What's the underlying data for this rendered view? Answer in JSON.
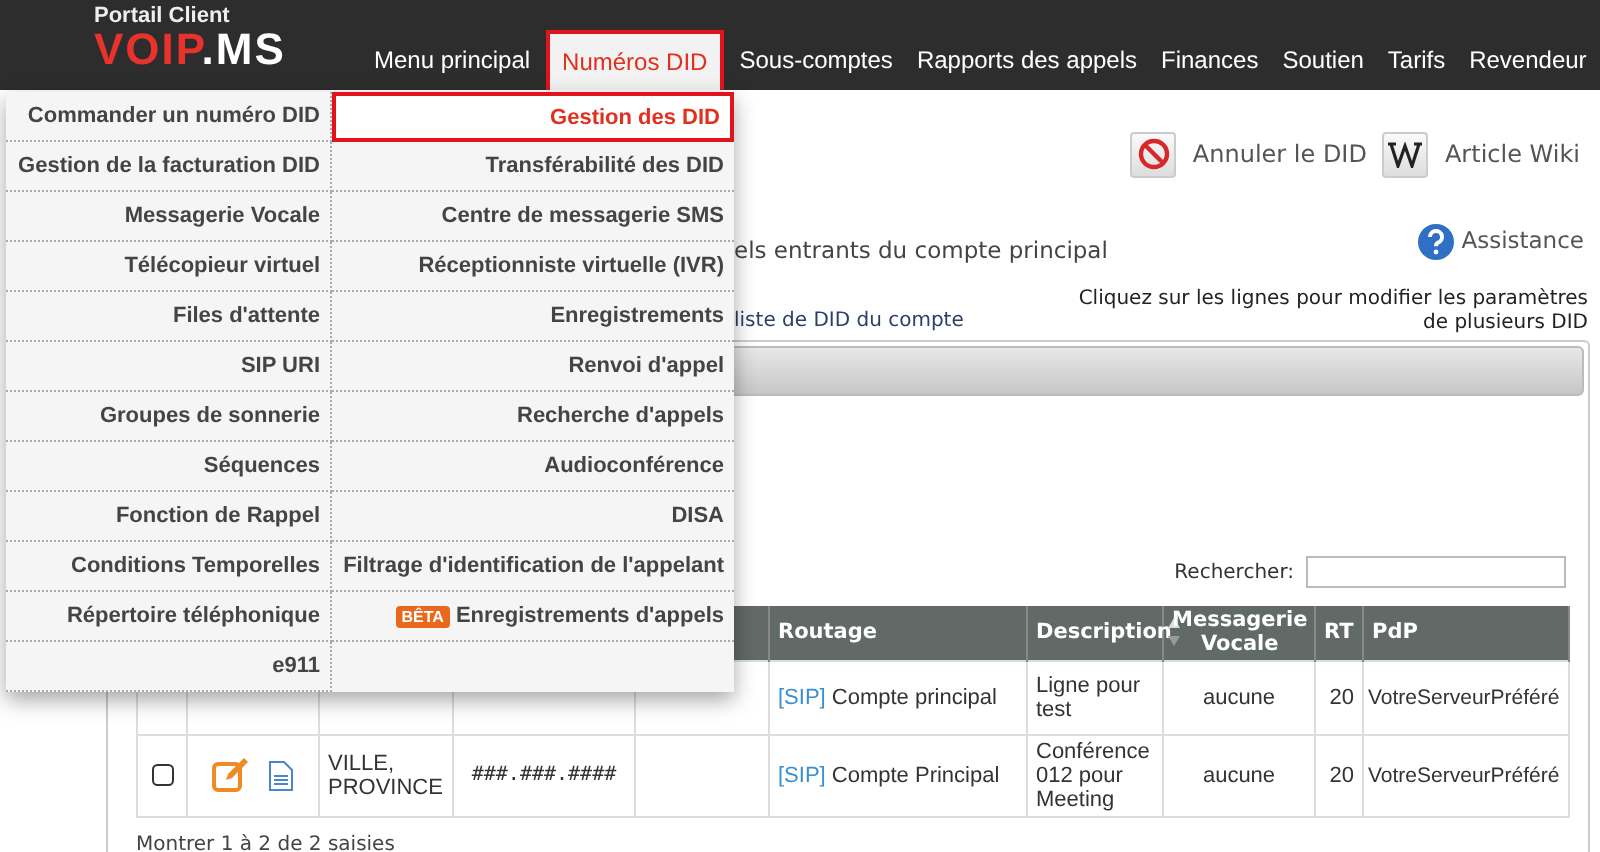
{
  "header": {
    "portal_label": "Portail Client",
    "logo": {
      "main": "VOIP",
      "suffix": ".MS"
    },
    "nav": [
      {
        "label": "Menu principal",
        "selected": false
      },
      {
        "label": "Numéros DID",
        "selected": true
      },
      {
        "label": "Sous-comptes",
        "selected": false
      },
      {
        "label": "Rapports des appels",
        "selected": false
      },
      {
        "label": "Finances",
        "selected": false
      },
      {
        "label": "Soutien",
        "selected": false
      },
      {
        "label": "Tarifs",
        "selected": false
      },
      {
        "label": "Revendeur",
        "selected": false
      }
    ]
  },
  "dropdown": {
    "items": [
      {
        "label": "Commander un numéro DID",
        "selected": false
      },
      {
        "label": "Gestion des DID",
        "selected": true
      },
      {
        "label": "Gestion de la facturation DID",
        "selected": false
      },
      {
        "label": "Transférabilité des DID",
        "selected": false
      },
      {
        "label": "Messagerie Vocale",
        "selected": false
      },
      {
        "label": "Centre de messagerie SMS",
        "selected": false
      },
      {
        "label": "Télécopieur virtuel",
        "selected": false
      },
      {
        "label": "Réceptionniste virtuelle (IVR)",
        "selected": false
      },
      {
        "label": "Files d'attente",
        "selected": false
      },
      {
        "label": "Enregistrements",
        "selected": false
      },
      {
        "label": "SIP URI",
        "selected": false
      },
      {
        "label": "Renvoi d'appel",
        "selected": false
      },
      {
        "label": "Groupes de sonnerie",
        "selected": false
      },
      {
        "label": "Recherche d'appels",
        "selected": false
      },
      {
        "label": "Séquences",
        "selected": false
      },
      {
        "label": "Audioconférence",
        "selected": false
      },
      {
        "label": "Fonction de Rappel",
        "selected": false
      },
      {
        "label": "DISA",
        "selected": false
      },
      {
        "label": "Conditions Temporelles",
        "selected": false
      },
      {
        "label": "Filtrage d'identification de l'appelant",
        "selected": false
      },
      {
        "label": "Répertoire téléphonique",
        "selected": false
      },
      {
        "label": "Enregistrements d'appels",
        "badge": "BÊTA",
        "selected": false
      },
      {
        "label": "e911",
        "selected": false
      }
    ]
  },
  "toolbar": [
    {
      "kind": "cancel",
      "label": "Annuler le DID"
    },
    {
      "kind": "wiki",
      "label": "Article Wiki"
    }
  ],
  "intro_text": "els entrants du compte principal",
  "help_link": "Assistance",
  "list_text": "liste de DID du compte",
  "hint_text": "Cliquez sur les lignes pour modifier les paramètres de plusieurs DID",
  "search": {
    "label": "Rechercher:"
  },
  "table": {
    "columns": [
      {
        "label": "Routage",
        "sorted": false
      },
      {
        "label": "Description",
        "sorted": true
      },
      {
        "label": "Messagerie Vocale",
        "sorted": false
      },
      {
        "label": "RT",
        "sorted": false
      },
      {
        "label": "PdP",
        "sorted": false
      }
    ],
    "rows": [
      {
        "route_tag": "[SIP]",
        "route": "Compte principal",
        "description": "Ligne pour test",
        "voicemail": "aucune",
        "rt": "20",
        "pdp": "VotreServeurPréféré"
      },
      {
        "checked": false,
        "location": "VILLE, PROVINCE",
        "number": "###.###.####",
        "route_tag": "[SIP]",
        "route": "Compte Principal",
        "description": "Conférence 012 pour Meeting",
        "voicemail": "aucune",
        "rt": "20",
        "pdp": "VotreServeurPréféré"
      }
    ]
  },
  "footer": "Montrer 1 à 2 de 2 saisies"
}
